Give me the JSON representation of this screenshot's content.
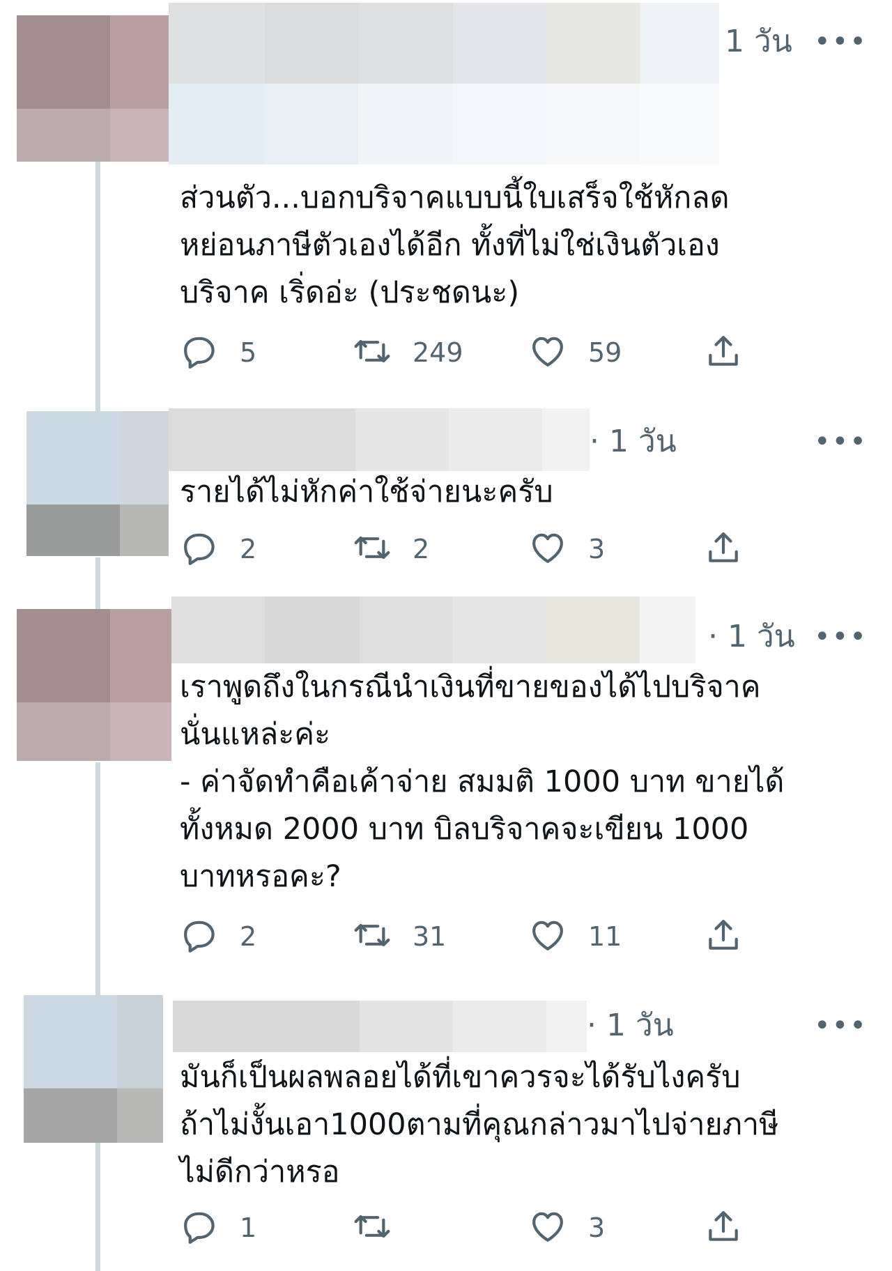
{
  "tweets": [
    {
      "time": "1 วัน",
      "more": "•••",
      "text": "ส่วนตัว...บอกบริจาคแบบนี้ใบเสร็จใช้หักลด\nหย่อนภาษีตัวเองได้อีก ทั้งที่ไม่ใช่เงินตัวเอง\nบริจาค เริ่ดอ่ะ (ประชดนะ)",
      "replies": "5",
      "retweets": "249",
      "likes": "59"
    },
    {
      "time": "· 1 วัน",
      "more": "•••",
      "text": "รายได้ไม่หักค่าใช้จ่ายนะครับ",
      "replies": "2",
      "retweets": "2",
      "likes": "3"
    },
    {
      "time": "· 1 วัน",
      "more": "•••",
      "text": "เราพูดถึงในกรณีนำเงินที่ขายของได้ไปบริจาค\nนั่นแหล่ะค่ะ\n- ค่าจัดทำคือเค้าจ่าย สมมติ 1000 บาท ขายได้\nทั้งหมด 2000 บาท บิลบริจาคจะเขียน 1000\nบาทหรอคะ?",
      "replies": "2",
      "retweets": "31",
      "likes": "11"
    },
    {
      "time": "· 1 วัน",
      "more": "•••",
      "text": "มันก็เป็นผลพลอยได้ที่เขาควรจะได้รับไงครับ\nถ้าไม่งั้นเอา1000ตามที่คุณกล่าวมาไปจ่ายภาษี\nไม่ดีกว่าหรอ",
      "replies": "1",
      "retweets": "",
      "likes": "3"
    }
  ],
  "icons": {
    "reply": "reply-icon",
    "retweet": "retweet-icon",
    "like": "like-icon",
    "share": "share-icon"
  },
  "colors": {
    "secondary_text": "#536471",
    "thread_line": "#cfd9de"
  }
}
